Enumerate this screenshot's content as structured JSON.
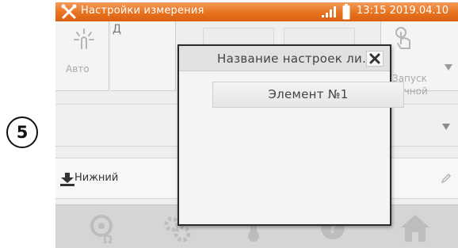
{
  "step_marker": "5",
  "status_bar": {
    "title": "Настройки измерения",
    "datetime": "13:15 2019.04.10",
    "icons": [
      "tools-icon",
      "signal-icon",
      "battery-icon"
    ]
  },
  "panel": {
    "options": [
      {
        "name": "auto",
        "label": "Авто",
        "icon": "auto-icon"
      },
      {
        "name": "partial",
        "label": "Д"
      },
      {
        "name": "manual",
        "label": "Запуск ручной",
        "icon": "hand-icon"
      }
    ],
    "lower_row_label": "Нижний"
  },
  "dialog": {
    "title": "Название настроек ли...",
    "items": [
      "Элемент №1"
    ]
  },
  "bottom_nav": {
    "icons": [
      "probe-icon",
      "settings-icon",
      "thermometer-icon",
      "help-icon",
      "home-icon"
    ]
  },
  "colors": {
    "status_bar": "#e8731f",
    "background": "#dcdcdc",
    "dialog_border": "#2a2a2a"
  }
}
